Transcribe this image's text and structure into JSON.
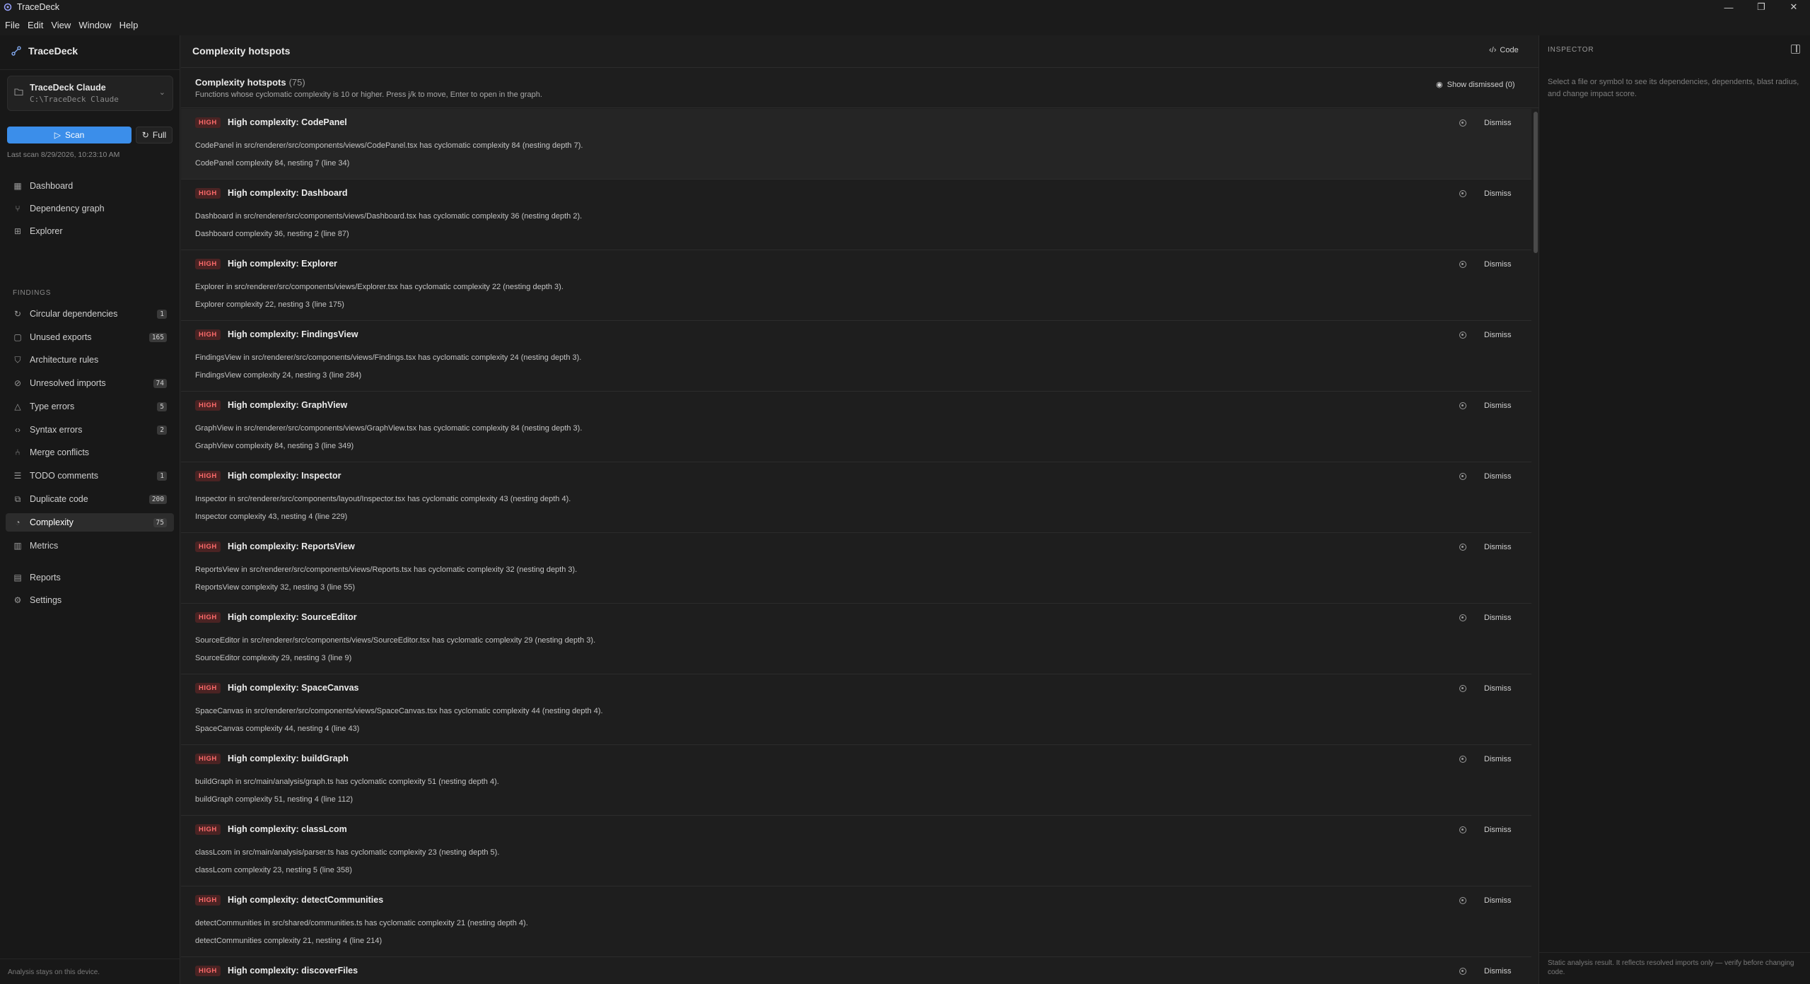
{
  "window": {
    "title": "TraceDeck",
    "controls": [
      "—",
      "❐",
      "✕"
    ]
  },
  "menu": [
    "File",
    "Edit",
    "View",
    "Window",
    "Help"
  ],
  "sidebar": {
    "brand": "TraceDeck",
    "project": {
      "name": "TraceDeck Claude",
      "path": "C:\\TraceDeck Claude"
    },
    "scan_label": "Scan",
    "full_label": "Full",
    "last_scan": "Last scan 8/29/2026, 10:23:10 AM",
    "nav_top": [
      {
        "label": "Dashboard",
        "icon": "grid-icon"
      },
      {
        "label": "Dependency graph",
        "icon": "graph-icon"
      },
      {
        "label": "Explorer",
        "icon": "tree-icon"
      }
    ],
    "section_findings": "FINDINGS",
    "findings": [
      {
        "label": "Circular dependencies",
        "badge": "1"
      },
      {
        "label": "Unused exports",
        "badge": "165"
      },
      {
        "label": "Architecture rules",
        "badge": ""
      },
      {
        "label": "Unresolved imports",
        "badge": "74"
      },
      {
        "label": "Type errors",
        "badge": "5"
      },
      {
        "label": "Syntax errors",
        "badge": "2"
      },
      {
        "label": "Merge conflicts",
        "badge": ""
      },
      {
        "label": "TODO comments",
        "badge": "1"
      },
      {
        "label": "Duplicate code",
        "badge": "200"
      },
      {
        "label": "Complexity",
        "badge": "75"
      },
      {
        "label": "Metrics",
        "badge": ""
      }
    ],
    "nav_bottom": [
      {
        "label": "Reports"
      },
      {
        "label": "Settings"
      }
    ],
    "footer": "Analysis stays on this device."
  },
  "main": {
    "page_title": "Complexity hotspots",
    "code_label": "Code",
    "sub_title": "Complexity hotspots",
    "sub_count": "(75)",
    "sub_desc": "Functions whose cyclomatic complexity is 10 or higher. Press j/k to move, Enter to open in the graph.",
    "show_dismissed": "Show dismissed (0)",
    "dismiss_label": "Dismiss",
    "rows": [
      {
        "sev": "HIGH",
        "title": "High complexity: CodePanel",
        "desc": "CodePanel in src/renderer/src/components/views/CodePanel.tsx has cyclomatic complexity 84 (nesting depth 7).",
        "loc": "CodePanel complexity 84, nesting 7 (line 34)"
      },
      {
        "sev": "HIGH",
        "title": "High complexity: Dashboard",
        "desc": "Dashboard in src/renderer/src/components/views/Dashboard.tsx has cyclomatic complexity 36 (nesting depth 2).",
        "loc": "Dashboard complexity 36, nesting 2 (line 87)"
      },
      {
        "sev": "HIGH",
        "title": "High complexity: Explorer",
        "desc": "Explorer in src/renderer/src/components/views/Explorer.tsx has cyclomatic complexity 22 (nesting depth 3).",
        "loc": "Explorer complexity 22, nesting 3 (line 175)"
      },
      {
        "sev": "HIGH",
        "title": "High complexity: FindingsView",
        "desc": "FindingsView in src/renderer/src/components/views/Findings.tsx has cyclomatic complexity 24 (nesting depth 3).",
        "loc": "FindingsView complexity 24, nesting 3 (line 284)"
      },
      {
        "sev": "HIGH",
        "title": "High complexity: GraphView",
        "desc": "GraphView in src/renderer/src/components/views/GraphView.tsx has cyclomatic complexity 84 (nesting depth 3).",
        "loc": "GraphView complexity 84, nesting 3 (line 349)"
      },
      {
        "sev": "HIGH",
        "title": "High complexity: Inspector",
        "desc": "Inspector in src/renderer/src/components/layout/Inspector.tsx has cyclomatic complexity 43 (nesting depth 4).",
        "loc": "Inspector complexity 43, nesting 4 (line 229)"
      },
      {
        "sev": "HIGH",
        "title": "High complexity: ReportsView",
        "desc": "ReportsView in src/renderer/src/components/views/Reports.tsx has cyclomatic complexity 32 (nesting depth 3).",
        "loc": "ReportsView complexity 32, nesting 3 (line 55)"
      },
      {
        "sev": "HIGH",
        "title": "High complexity: SourceEditor",
        "desc": "SourceEditor in src/renderer/src/components/views/SourceEditor.tsx has cyclomatic complexity 29 (nesting depth 3).",
        "loc": "SourceEditor complexity 29, nesting 3 (line 9)"
      },
      {
        "sev": "HIGH",
        "title": "High complexity: SpaceCanvas",
        "desc": "SpaceCanvas in src/renderer/src/components/views/SpaceCanvas.tsx has cyclomatic complexity 44 (nesting depth 4).",
        "loc": "SpaceCanvas complexity 44, nesting 4 (line 43)"
      },
      {
        "sev": "HIGH",
        "title": "High complexity: buildGraph",
        "desc": "buildGraph in src/main/analysis/graph.ts has cyclomatic complexity 51 (nesting depth 4).",
        "loc": "buildGraph complexity 51, nesting 4 (line 112)"
      },
      {
        "sev": "HIGH",
        "title": "High complexity: classLcom",
        "desc": "classLcom in src/main/analysis/parser.ts has cyclomatic complexity 23 (nesting depth 5).",
        "loc": "classLcom complexity 23, nesting 5 (line 358)"
      },
      {
        "sev": "HIGH",
        "title": "High complexity: detectCommunities",
        "desc": "detectCommunities in src/shared/communities.ts has cyclomatic complexity 21 (nesting depth 4).",
        "loc": "detectCommunities complexity 21, nesting 4 (line 214)"
      },
      {
        "sev": "HIGH",
        "title": "High complexity: discoverFiles",
        "desc": "",
        "loc": ""
      }
    ]
  },
  "inspector": {
    "title": "INSPECTOR",
    "message": "Select a file or symbol to see its dependencies, dependents, blast radius, and change impact score.",
    "footer": "Static analysis result. It reflects resolved imports only — verify before changing code."
  },
  "colors": {
    "accent": "#3b8eea",
    "high": "#ff6b6b",
    "high_bg": "#4a2323"
  }
}
